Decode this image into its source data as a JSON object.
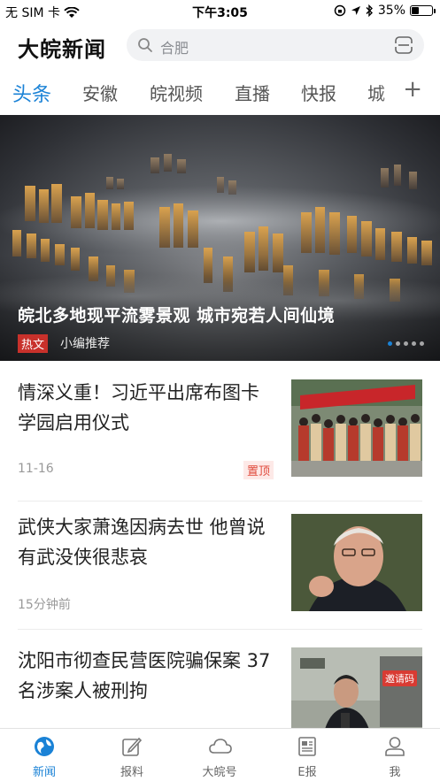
{
  "status_bar": {
    "carrier": "无 SIM 卡",
    "time": "下午3:05",
    "battery": "35%",
    "battery_level": 0.35
  },
  "header": {
    "app_name": "大皖新闻",
    "search_placeholder": "合肥"
  },
  "tabs": [
    {
      "label": "头条",
      "active": true
    },
    {
      "label": "安徽",
      "active": false
    },
    {
      "label": "皖视频",
      "active": false
    },
    {
      "label": "直播",
      "active": false
    },
    {
      "label": "快报",
      "active": false
    },
    {
      "label": "城",
      "active": false
    }
  ],
  "hero": {
    "title": "皖北多地现平流雾景观 城市宛若人间仙境",
    "tag": "热文",
    "source": "小编推荐",
    "slide_count": 5,
    "active_slide": 1
  },
  "news": [
    {
      "headline": "情深义重！习近平出席布图卡学园启用仪式",
      "meta": "11-16",
      "pin": "置顶"
    },
    {
      "headline": "武侠大家萧逸因病去世 他曾说有武没侠很悲哀",
      "meta": "15分钟前"
    },
    {
      "headline": "沈阳市彻查民营医院骗保案 37名涉案人被刑拘",
      "meta": "",
      "thumb_badge": "邀请码"
    }
  ],
  "bottom_nav": [
    {
      "label": "新闻",
      "icon": "globe-icon",
      "active": true
    },
    {
      "label": "报料",
      "icon": "edit-icon",
      "active": false
    },
    {
      "label": "大皖号",
      "icon": "cloud-icon",
      "active": false
    },
    {
      "label": "E报",
      "icon": "newspaper-icon",
      "active": false
    },
    {
      "label": "我",
      "icon": "user-icon",
      "active": false
    }
  ],
  "colors": {
    "accent": "#1a82d6",
    "tag_red": "#c8312b",
    "pin_red": "#e04a3c"
  }
}
